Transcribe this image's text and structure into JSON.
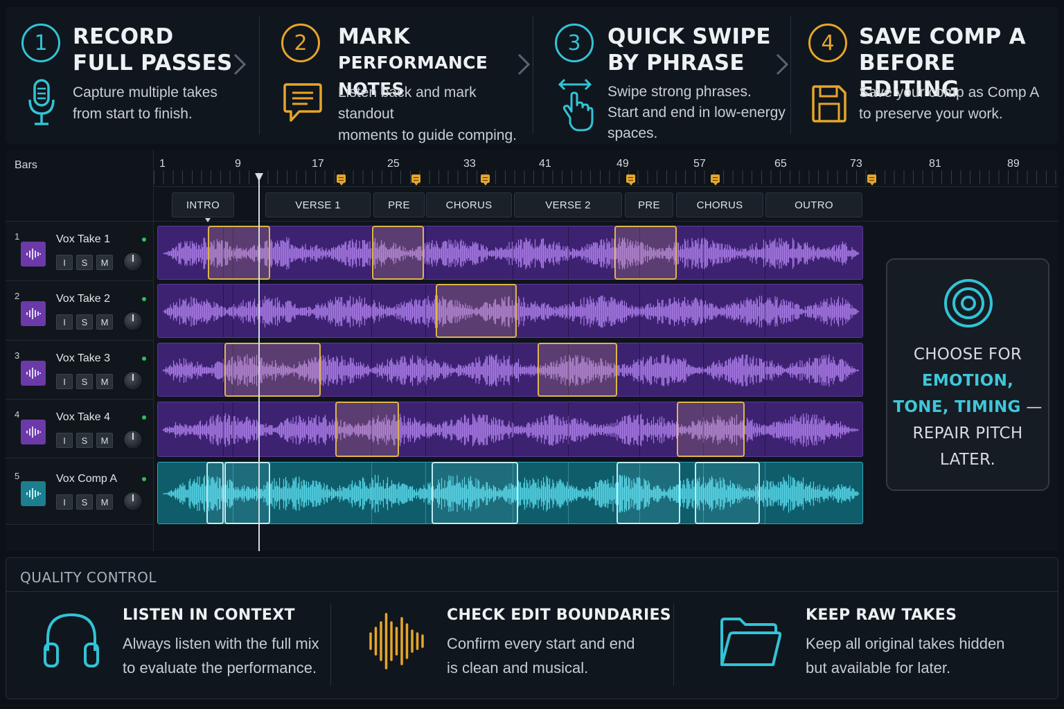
{
  "steps": [
    {
      "num": "1",
      "title1": "RECORD",
      "title2": "FULL PASSES",
      "desc": [
        "Capture multiple takes",
        "from start to finish."
      ],
      "icon": "microphone-icon",
      "color": "#33c3d6"
    },
    {
      "num": "2",
      "title1": "MARK",
      "title2": "PERFORMANCE NOTES",
      "desc": [
        "Listen back and mark standout",
        "moments to guide comping."
      ],
      "icon": "comment-icon",
      "color": "#e6a52a"
    },
    {
      "num": "3",
      "title1": "QUICK SWIPE",
      "title2": "BY PHRASE",
      "desc": [
        "Swipe strong phrases.",
        "Start and end in low-energy",
        "spaces."
      ],
      "icon": "swipe-hand-icon",
      "color": "#33c3d6"
    },
    {
      "num": "4",
      "title1": "SAVE COMP A",
      "title2": "BEFORE EDITING",
      "desc": [
        "Save your comp as Comp A",
        "to preserve your work."
      ],
      "icon": "save-icon",
      "color": "#e6a52a"
    }
  ],
  "timeline": {
    "bars_label": "Bars",
    "bar_numbers": [
      "1",
      "9",
      "17",
      "25",
      "33",
      "41",
      "49",
      "57",
      "65",
      "73",
      "81",
      "89"
    ],
    "sections": [
      "INTRO",
      "VERSE 1",
      "PRE",
      "CHORUS",
      "VERSE 2",
      "PRE",
      "CHORUS",
      "OUTRO"
    ]
  },
  "tracks": [
    {
      "num": "1",
      "name": "Vox Take 1",
      "buttons": [
        "I",
        "S",
        "M"
      ]
    },
    {
      "num": "2",
      "name": "Vox Take 2",
      "buttons": [
        "I",
        "S",
        "M"
      ]
    },
    {
      "num": "3",
      "name": "Vox Take 3",
      "buttons": [
        "I",
        "S",
        "M"
      ]
    },
    {
      "num": "4",
      "name": "Vox Take 4",
      "buttons": [
        "I",
        "S",
        "M"
      ]
    },
    {
      "num": "5",
      "name": "Vox Comp A",
      "buttons": [
        "I",
        "S",
        "M"
      ]
    }
  ],
  "tip": {
    "icon": "target-icon",
    "line1": "CHOOSE FOR",
    "line2": "EMOTION,",
    "line3a": "TONE, TIMING",
    "line3b": " —",
    "line4": "REPAIR PITCH",
    "line5": "LATER."
  },
  "quality_control": {
    "title": "QUALITY CONTROL",
    "items": [
      {
        "head": "LISTEN IN CONTEXT",
        "desc": [
          "Always listen with the full mix",
          "to evaluate the performance."
        ],
        "icon": "headphones-icon"
      },
      {
        "head": "CHECK EDIT BOUNDARIES",
        "desc": [
          "Confirm every start and end",
          "is clean and musical."
        ],
        "icon": "waveform-icon"
      },
      {
        "head": "KEEP RAW TAKES",
        "desc": [
          "Keep all original takes hidden",
          "but available for later."
        ],
        "icon": "folder-icon"
      }
    ]
  },
  "colors": {
    "accent_teal": "#33c3d6",
    "accent_orange": "#e6a52a",
    "take_purple": "#4c2a82",
    "comp_teal": "#12707f"
  }
}
